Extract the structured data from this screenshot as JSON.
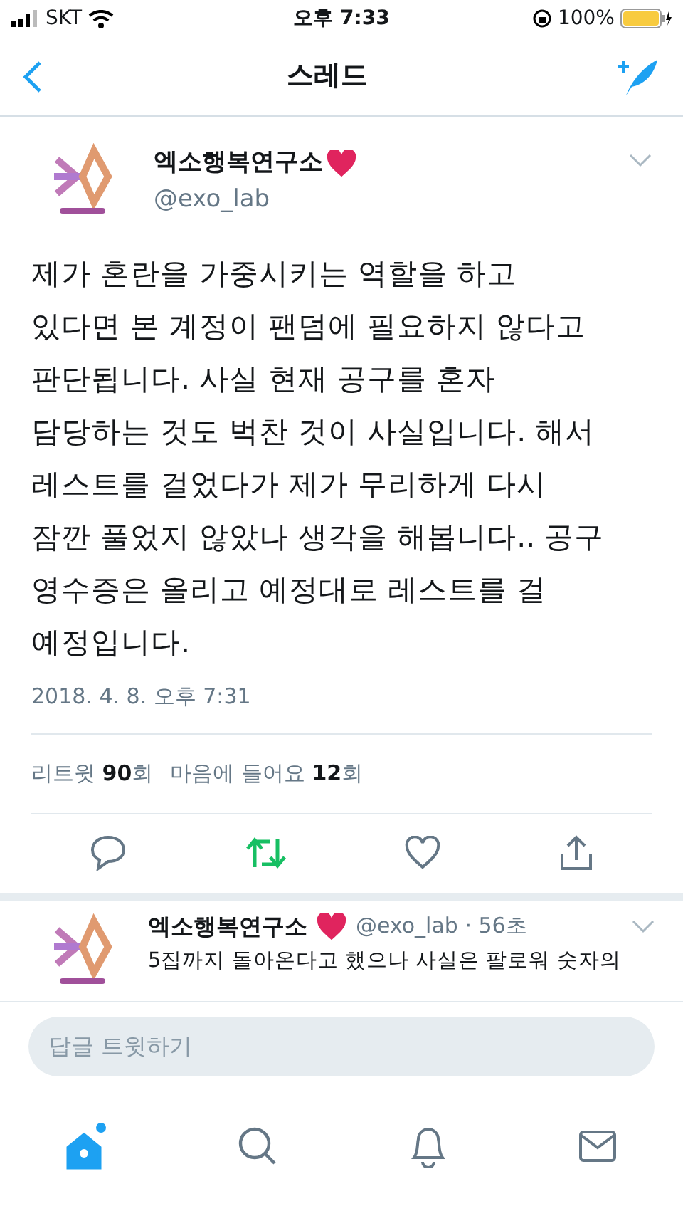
{
  "status_bar": {
    "carrier": "SKT",
    "time": "오후 7:33",
    "battery": "100%"
  },
  "nav": {
    "title": "스레드"
  },
  "tweet": {
    "name": "엑소행복연구소",
    "handle": "@exo_lab",
    "text": "제가 혼란을 가중시키는 역할을 하고\n있다면 본 계정이 팬덤에 필요하지 않다고\n판단됩니다. 사실 현재 공구를 혼자\n담당하는 것도 벅찬 것이 사실입니다. 해서\n레스트를 걸었다가 제가 무리하게 다시\n잠깐 풀었지 않았나 생각을 해봅니다.. 공구\n영수증은 올리고 예정대로 레스트를 걸\n예정입니다.",
    "date": "2018. 4. 8. 오후 7:31",
    "retweet_label": "리트윗",
    "retweet_count": "90",
    "retweet_unit": "회",
    "like_label": "마음에 들어요",
    "like_count": "12",
    "like_unit": "회",
    "retweeted": true,
    "liked": false
  },
  "reply_tweet": {
    "name": "엑소행복연구소",
    "handle": "@exo_lab · 56초",
    "text": "5집까지 돌아온다고 했으나 사실은 팔로워 숫자의"
  },
  "reply_field": {
    "placeholder": "답글 트윗하기"
  },
  "tabs": [
    {
      "kind": "home",
      "selected": true
    },
    {
      "kind": "search",
      "selected": false
    },
    {
      "kind": "notifications",
      "selected": false
    },
    {
      "kind": "messages",
      "selected": false
    }
  ]
}
